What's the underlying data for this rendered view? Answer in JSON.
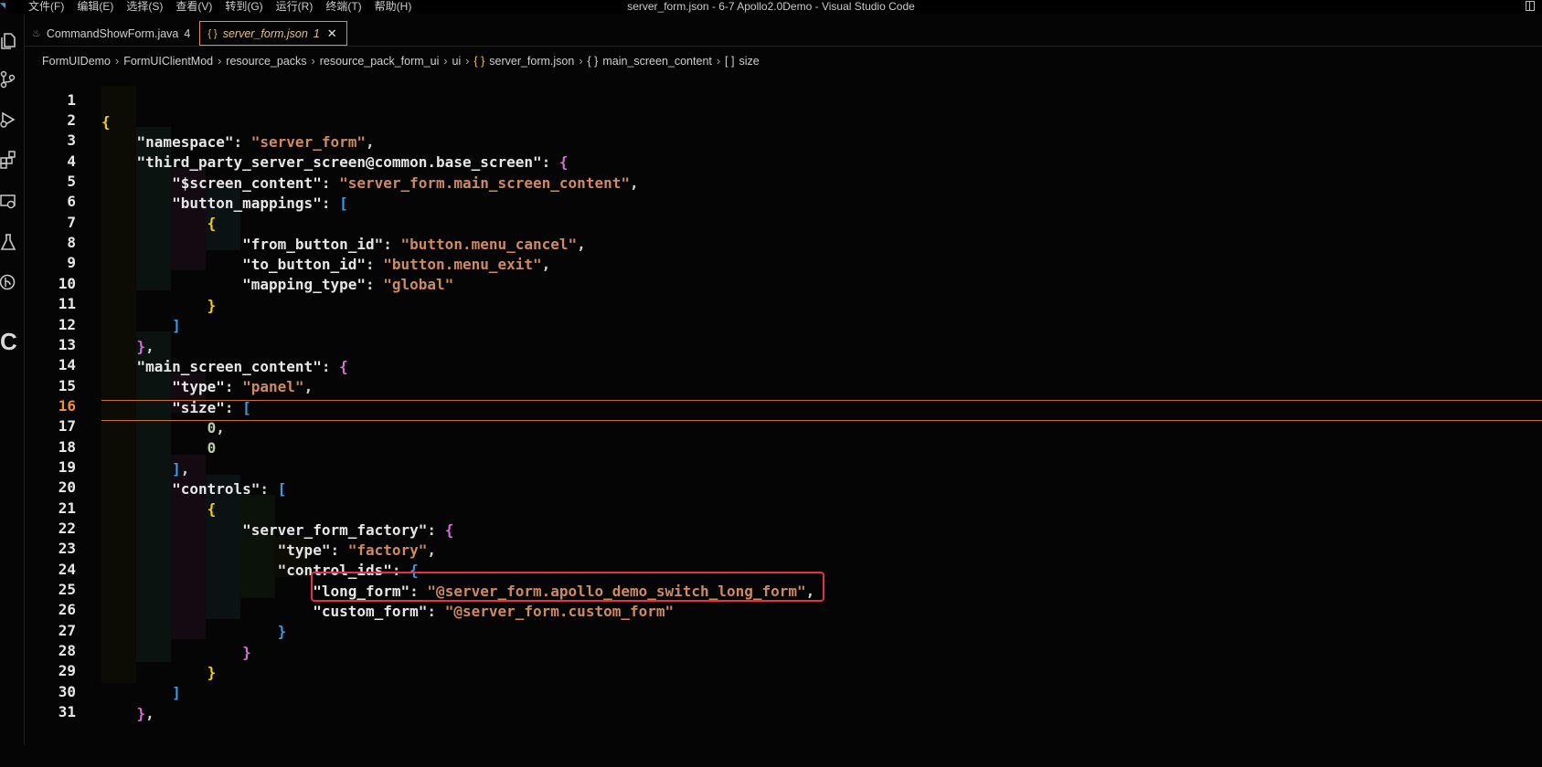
{
  "window": {
    "title": "server_form.json - 6-7 Apollo2.0Demo - Visual Studio Code",
    "menu": [
      "文件(F)",
      "编辑(E)",
      "选择(S)",
      "查看(V)",
      "转到(G)",
      "运行(R)",
      "终端(T)",
      "帮助(H)"
    ]
  },
  "activity_bar": {
    "icons": [
      "explorer-icon",
      "source-control-icon",
      "run-debug-icon",
      "extensions-icon",
      "remote-explorer-icon",
      "testing-icon",
      "gitlens-icon"
    ],
    "letter": "C"
  },
  "tabs": [
    {
      "label": "CommandShowForm.java",
      "badge": "4",
      "icon": "java-file-icon",
      "active": false
    },
    {
      "label": "server_form.json",
      "badge": "1",
      "icon": "{ }",
      "active": true
    }
  ],
  "breadcrumb": [
    "FormUIDemo",
    "FormUIClientMod",
    "resource_packs",
    "resource_pack_form_ui",
    "ui",
    "server_form.json",
    "main_screen_content",
    "size"
  ],
  "breadcrumb_icons": {
    "file": "{ }",
    "object": "{ }",
    "array": "[ ]"
  },
  "editor": {
    "active_line": 16,
    "highlight_line": 24,
    "lines": [
      {
        "n": "1",
        "text": "{"
      },
      {
        "n": "2",
        "text": "    \"namespace\": \"server_form\","
      },
      {
        "n": "3",
        "text": "    \"third_party_server_screen@common.base_screen\": {"
      },
      {
        "n": "4",
        "text": "        \"$screen_content\": \"server_form.main_screen_content\","
      },
      {
        "n": "5",
        "text": "        \"button_mappings\": ["
      },
      {
        "n": "6",
        "text": "            {"
      },
      {
        "n": "7",
        "text": "                \"from_button_id\": \"button.menu_cancel\","
      },
      {
        "n": "8",
        "text": "                \"to_button_id\": \"button.menu_exit\","
      },
      {
        "n": "9",
        "text": "                \"mapping_type\": \"global\""
      },
      {
        "n": "10",
        "text": "            }"
      },
      {
        "n": "11",
        "text": "        ]"
      },
      {
        "n": "12",
        "text": "    },"
      },
      {
        "n": "13",
        "text": "    \"main_screen_content\": {"
      },
      {
        "n": "14",
        "text": "        \"type\": \"panel\","
      },
      {
        "n": "15",
        "text": "        \"size\": ["
      },
      {
        "n": "16",
        "text": "            0,"
      },
      {
        "n": "17",
        "text": "            0"
      },
      {
        "n": "18",
        "text": "        ],"
      },
      {
        "n": "19",
        "text": "        \"controls\": ["
      },
      {
        "n": "20",
        "text": "            {"
      },
      {
        "n": "21",
        "text": "                \"server_form_factory\": {"
      },
      {
        "n": "22",
        "text": "                    \"type\": \"factory\","
      },
      {
        "n": "23",
        "text": "                    \"control_ids\": {"
      },
      {
        "n": "24",
        "text": "                        \"long_form\": \"@server_form.apollo_demo_switch_long_form\","
      },
      {
        "n": "25",
        "text": "                        \"custom_form\": \"@server_form.custom_form\""
      },
      {
        "n": "26",
        "text": "                    }"
      },
      {
        "n": "27",
        "text": "                }"
      },
      {
        "n": "28",
        "text": "            }"
      },
      {
        "n": "29",
        "text": "        ]"
      },
      {
        "n": "30",
        "text": "    },"
      },
      {
        "n": "31",
        "text": ""
      }
    ]
  },
  "colors": {
    "background": "#050505",
    "key": "#e6e6e6",
    "string": "#ce8a62",
    "number": "#b5cea8",
    "bracket_1": "#f2cf1d",
    "bracket_2": "#d66fd6",
    "bracket_3": "#3b9be8",
    "active_line_border": "#c8702d",
    "highlight_box": "#e0324a",
    "active_tab_border": "#e48b52"
  }
}
